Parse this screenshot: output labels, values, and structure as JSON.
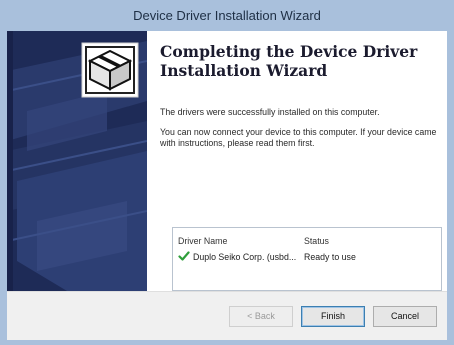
{
  "window": {
    "title": "Device Driver Installation Wizard"
  },
  "wizard": {
    "heading": "Completing the Device Driver Installation Wizard",
    "message1": "The drivers were successfully installed on this computer.",
    "message2": "You can now connect your device to this computer. If your device came with instructions, please read them first.",
    "table": {
      "columns": [
        "Driver Name",
        "Status"
      ],
      "rows": [
        {
          "name": "Duplo Seiko Corp. (usbd...",
          "status": "Ready to use",
          "icon": "checkmark-icon"
        }
      ]
    }
  },
  "buttons": {
    "back": "< Back",
    "finish": "Finish",
    "cancel": "Cancel"
  },
  "colors": {
    "title_bar": "#a9c0dc",
    "banner": "#1e2b57",
    "check": "#2e9e3a"
  }
}
